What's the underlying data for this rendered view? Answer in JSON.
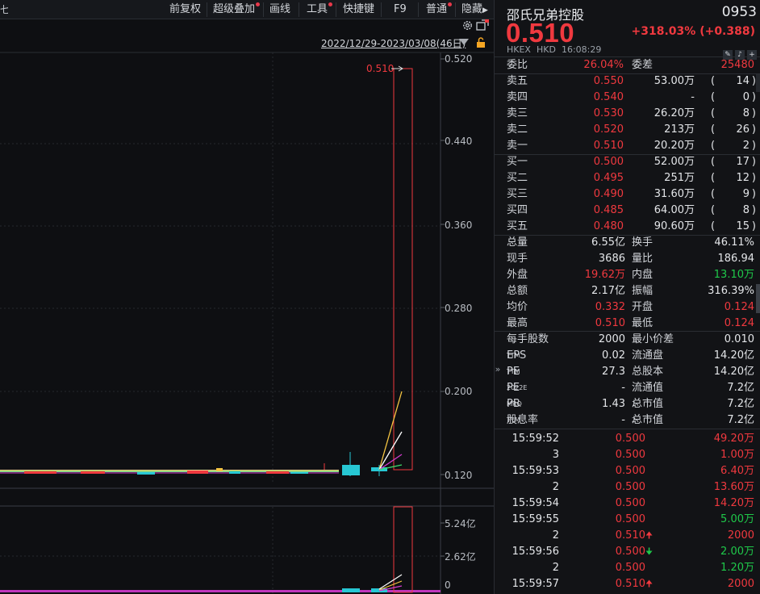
{
  "toolbar": {
    "left_crumb": "七",
    "items": [
      {
        "label": "前复权",
        "dot": false
      },
      {
        "label": "超级叠加",
        "dot": true
      },
      {
        "label": "画线",
        "dot": false
      },
      {
        "label": "工具",
        "dot": true
      },
      {
        "label": "快捷键",
        "dot": false
      },
      {
        "label": "F9",
        "dot": false
      },
      {
        "label": "普通",
        "dot": true
      },
      {
        "label": "隐藏",
        "dot": false
      }
    ]
  },
  "chart": {
    "date_range": "2022/12/29-2023/03/08(46日)",
    "last_price_label": "0.510",
    "price_axis": [
      "0.520",
      "0.440",
      "0.360",
      "0.280",
      "0.200",
      "0.120"
    ],
    "volume_axis": [
      "5.24亿",
      "2.62亿",
      "0"
    ],
    "colors": {
      "up": "#f0393f",
      "down": "#27c7d4",
      "ma5": "#ffffff",
      "ma10": "#f5c542",
      "ma20": "#d43bd0",
      "ma60": "#3bdc6a"
    }
  },
  "quote": {
    "name": "邵氏兄弟控股",
    "code": "0953",
    "price": "0.510",
    "change": "+318.03% (+0.388)",
    "exchange": "HKEX",
    "currency": "HKD",
    "time": "16:08:29",
    "wei_bi_label": "委比",
    "wei_bi": "26.04%",
    "wei_cha_label": "委差",
    "wei_cha": "25480"
  },
  "orderbook": {
    "asks": [
      {
        "label": "卖五",
        "price": "0.550",
        "vol": "53.00万",
        "count": "14"
      },
      {
        "label": "卖四",
        "price": "0.540",
        "vol": "-",
        "count": "0"
      },
      {
        "label": "卖三",
        "price": "0.530",
        "vol": "26.20万",
        "count": "8"
      },
      {
        "label": "卖二",
        "price": "0.520",
        "vol": "213万",
        "count": "26"
      },
      {
        "label": "卖一",
        "price": "0.510",
        "vol": "20.20万",
        "count": "2"
      }
    ],
    "bids": [
      {
        "label": "买一",
        "price": "0.500",
        "vol": "52.00万",
        "count": "17"
      },
      {
        "label": "买二",
        "price": "0.495",
        "vol": "251万",
        "count": "12"
      },
      {
        "label": "买三",
        "price": "0.490",
        "vol": "31.60万",
        "count": "9"
      },
      {
        "label": "买四",
        "price": "0.485",
        "vol": "64.00万",
        "count": "8"
      },
      {
        "label": "买五",
        "price": "0.480",
        "vol": "90.60万",
        "count": "15"
      }
    ]
  },
  "stats": [
    {
      "l1": "总量",
      "v1": "6.55亿",
      "c1": "white",
      "l2": "换手",
      "v2": "46.11%",
      "c2": "white"
    },
    {
      "l1": "现手",
      "v1": "3686",
      "c1": "white",
      "l2": "量比",
      "v2": "186.94",
      "c2": "white"
    },
    {
      "l1": "外盘",
      "v1": "19.62万",
      "c1": "red",
      "l2": "内盘",
      "v2": "13.10万",
      "c2": "green"
    },
    {
      "l1": "总额",
      "v1": "2.17亿",
      "c1": "white",
      "l2": "振幅",
      "v2": "316.39%",
      "c2": "white"
    },
    {
      "l1": "均价",
      "v1": "0.332",
      "c1": "red",
      "l2": "开盘",
      "v2": "0.124",
      "c2": "red"
    },
    {
      "l1": "最高",
      "v1": "0.510",
      "c1": "red",
      "l2": "最低",
      "v2": "0.124",
      "c2": "red"
    }
  ],
  "fundamentals": [
    {
      "l1": "每手股数",
      "sup1": "",
      "v1": "2000",
      "l2": "最小价差",
      "sup2": "",
      "v2": "0.010"
    },
    {
      "l1": "EPS",
      "sup1": "TTM",
      "v1": "0.02",
      "l2": "流通盘",
      "sup2": "",
      "v2": "14.20亿"
    },
    {
      "l1": "PE",
      "sup1": "TTM",
      "v1": "27.3",
      "l2": "总股本",
      "sup2": "",
      "v2": "14.20亿"
    },
    {
      "l1": "PE",
      "sup1": "2022E",
      "v1": "-",
      "l2": "流通值",
      "sup2": "",
      "v2": "7.2亿"
    },
    {
      "l1": "PB",
      "sup1": "MRQ",
      "v1": "1.43",
      "l2": "总市值",
      "sup2": "1",
      "v2": "7.2亿"
    },
    {
      "l1": "股息率",
      "sup1": "TTM",
      "v1": "-",
      "l2": "总市值",
      "sup2": "2",
      "v2": "7.2亿"
    }
  ],
  "ticks": [
    {
      "time": "15:59:52",
      "price": "0.500",
      "dir": "",
      "vol": "49.20万",
      "vc": "red"
    },
    {
      "time": "3",
      "price": "0.500",
      "dir": "",
      "vol": "1.00万",
      "vc": "red"
    },
    {
      "time": "15:59:53",
      "price": "0.500",
      "dir": "",
      "vol": "6.40万",
      "vc": "red"
    },
    {
      "time": "2",
      "price": "0.500",
      "dir": "",
      "vol": "13.60万",
      "vc": "red"
    },
    {
      "time": "15:59:54",
      "price": "0.500",
      "dir": "",
      "vol": "14.20万",
      "vc": "red"
    },
    {
      "time": "15:59:55",
      "price": "0.500",
      "dir": "",
      "vol": "5.00万",
      "vc": "green"
    },
    {
      "time": "2",
      "price": "0.510",
      "dir": "up",
      "vol": "2000",
      "vc": "red"
    },
    {
      "time": "15:59:56",
      "price": "0.500",
      "dir": "down",
      "vol": "2.00万",
      "vc": "green"
    },
    {
      "time": "2",
      "price": "0.500",
      "dir": "",
      "vol": "1.20万",
      "vc": "green"
    },
    {
      "time": "15:59:57",
      "price": "0.510",
      "dir": "up",
      "vol": "2000",
      "vc": "red"
    }
  ]
}
